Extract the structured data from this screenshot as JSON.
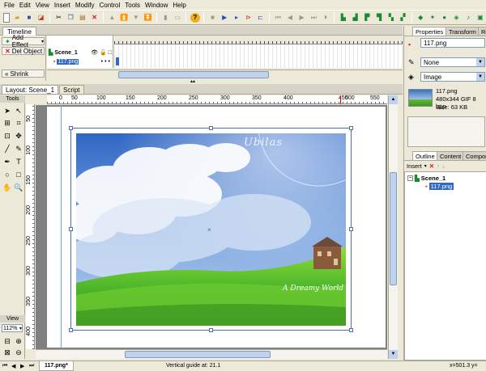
{
  "menu": [
    "File",
    "Edit",
    "View",
    "Insert",
    "Modify",
    "Control",
    "Tools",
    "Window",
    "Help"
  ],
  "timeline": {
    "tab_label": "Timeline",
    "add_effect_label": "Add Effect",
    "del_object_label": "Del Object",
    "shrink_label": "Shrink",
    "layers": [
      "Scene_1",
      "117.png"
    ]
  },
  "document_tabs": [
    "Layout: Scene_1",
    "Script"
  ],
  "tools_label": "Tools",
  "view_label": "View",
  "zoom_value": "112%",
  "ruler": {
    "h": [
      "0",
      "50",
      "100",
      "150",
      "200",
      "250",
      "300",
      "350",
      "400",
      "450",
      "500",
      "550"
    ],
    "v": [
      "50",
      "100",
      "150",
      "200",
      "250",
      "300",
      "350",
      "400"
    ]
  },
  "photo": {
    "title_text": "A Dreamy World",
    "logo_text": "Ubilas"
  },
  "colors": {
    "sky_top": "#3b6fc0",
    "sky_mid": "#8fb3e3",
    "grass": "#5fb92a",
    "selection": "#4a6ea8",
    "highlight": "#316ac5"
  },
  "properties": {
    "tabs": [
      "Properties",
      "Transform",
      "Re"
    ],
    "name_value": "117.png",
    "blend_value": "None",
    "type_value": "Image",
    "info_name": "117.png",
    "info_dims": "480x344 GIF 8 bpp",
    "info_size": "Size: 63 KB"
  },
  "outline": {
    "tabs": [
      "Outline",
      "Content",
      "Compor"
    ],
    "insert_label": "Insert",
    "scene": "Scene_1",
    "child": "117.png"
  },
  "status": {
    "file_tab": "117.png*",
    "guide_text": "Vertical guide at: 21.1",
    "coords": "x=501.3 y="
  }
}
